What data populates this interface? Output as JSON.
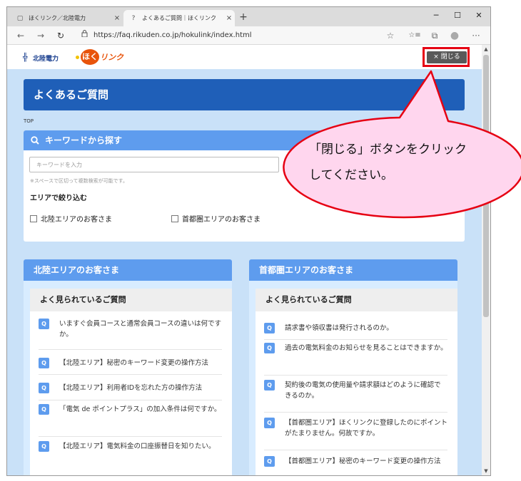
{
  "browser": {
    "tabs": [
      {
        "label": "ほくリンク／北陸電力",
        "icon": "page-icon",
        "close": "×"
      },
      {
        "label": "よくあるご質問｜ほくリンク",
        "icon": "help-icon",
        "close": "×"
      }
    ],
    "new_tab": "+",
    "window_controls": {
      "minimize": "─",
      "maximize": "☐",
      "close": "✕"
    },
    "nav": {
      "back": "←",
      "forward": "→",
      "refresh": "↻"
    },
    "lock": "🔒",
    "url": "https://faq.rikuden.co.jp/hokulink/index.html",
    "toolbar_icons": {
      "favorite": "☆",
      "favorites_list": "☆≡",
      "collections": "⧉",
      "profile": "●",
      "more": "···"
    }
  },
  "site": {
    "logo_mark": "╬",
    "logo_text": "北陸電力",
    "hoku_circle": "ほく",
    "hoku_rest": "リンク",
    "close_button": "× 閉じる"
  },
  "page": {
    "title": "よくあるご質問",
    "breadcrumb": "TOP",
    "keyword": {
      "heading": "キーワードから探す",
      "placeholder": "キーワードを入力",
      "note": "※スペースで区切って複数検索が可能です。",
      "area_title": "エリアで絞り込む",
      "options": [
        "北陸エリアのお客さま",
        "首都圏エリアのお客さま"
      ]
    },
    "columns": [
      {
        "heading": "北陸エリアのお客さま",
        "subheading": "よく見られているご質問",
        "questions": [
          "いますぐ会員コースと通常会員コースの違いは何ですか。",
          "【北陸エリア】秘密のキーワード変更の操作方法",
          "【北陸エリア】利用者IDを忘れた方の操作方法",
          "「電気 de ポイントプラス」の加入条件は何ですか。",
          "【北陸エリア】電気料金の口座振替日を知りたい。"
        ]
      },
      {
        "heading": "首都圏エリアのお客さま",
        "subheading": "よく見られているご質問",
        "questions": [
          "請求書や領収書は発行されるのか。",
          "過去の電気料金のお知らせを見ることはできますか。",
          "契約後の電気の使用量や請求額はどのように確認できるのか。",
          "【首都圏エリア】ほくリンクに登録したのにポイントがたまりません。何故ですか。",
          "【首都圏エリア】秘密のキーワード変更の操作方法"
        ]
      }
    ],
    "q_badge": "Q"
  },
  "annotation": {
    "callout_lines": [
      "「閉じる」ボタンをクリック",
      "してください。"
    ],
    "colors": {
      "highlight": "#e60012",
      "bubble_fill": "#ffd6ee",
      "bubble_stroke": "#e60012"
    }
  }
}
